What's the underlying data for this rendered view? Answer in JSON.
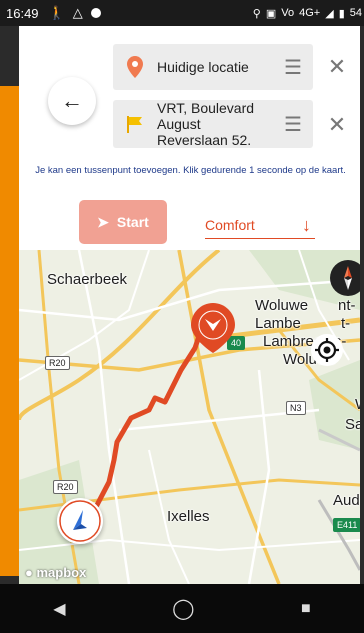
{
  "status_bar": {
    "time": "16:49",
    "right_text": "4G+",
    "battery": "54"
  },
  "route": {
    "from": "Huidige locatie",
    "to_line1": "VRT, Boulevard",
    "to_line2": "August",
    "to_line3": "Reverslaan 52."
  },
  "hint": "Je kan een tussenpunt toevoegen. Klik gedurende 1 seconde op de kaart.",
  "actions": {
    "start_label": "Start",
    "profile_label": "Comfort"
  },
  "map": {
    "places": {
      "schaerbeek": "Schaerbeek",
      "woluwe1": "Woluwe",
      "woluwe_frag": "nt-",
      "lambe": "Lambe",
      "lambe_frag": "t-",
      "lambrecht": "Lambrecnts-",
      "woluwe2": "Woluwe",
      "ixelles": "Ixelles",
      "sa": "Sa",
      "aud": "Aud",
      "w": "W"
    },
    "roads": [
      "R20",
      "R20",
      "N3",
      "E411",
      "40"
    ],
    "attribution": "mapbox"
  },
  "colors": {
    "accent": "#e04a24",
    "start_bg": "#f1a193",
    "orange_edge": "#f08a00",
    "route": "#e04a24",
    "nav_arrow": "#2f6fd6"
  }
}
